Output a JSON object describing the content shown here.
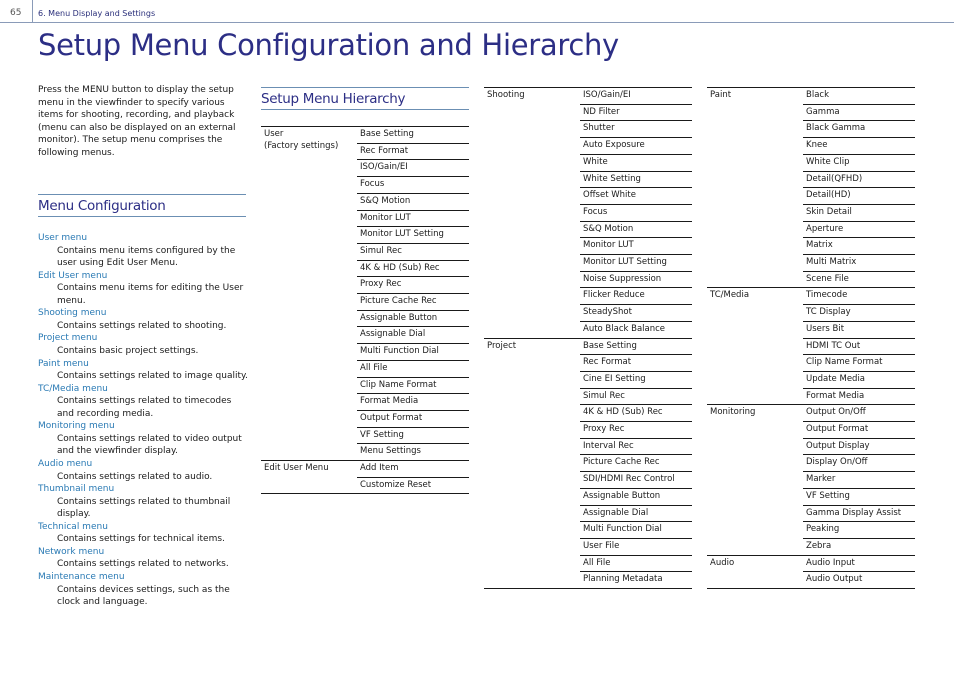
{
  "header": {
    "page_number": "65",
    "section": "6. Menu Display and Settings"
  },
  "title": "Setup Menu Configuration and Hierarchy",
  "intro": "Press the MENU button to display the setup menu in the viewfinder to specify various items for shooting, recording, and playback (menu can also be displayed on an external monitor). The setup menu comprises the following menus.",
  "menu_configuration": {
    "heading": "Menu Configuration",
    "entries": [
      {
        "name": "User menu",
        "desc": "Contains menu items configured by the user using Edit User Menu."
      },
      {
        "name": "Edit User menu",
        "desc": "Contains menu items for editing the User menu."
      },
      {
        "name": "Shooting menu",
        "desc": "Contains settings related to shooting."
      },
      {
        "name": "Project menu",
        "desc": "Contains basic project settings."
      },
      {
        "name": "Paint menu",
        "desc": "Contains settings related to image quality."
      },
      {
        "name": "TC/Media menu",
        "desc": "Contains settings related to timecodes and recording media."
      },
      {
        "name": "Monitoring menu",
        "desc": "Contains settings related to video output and the viewfinder display."
      },
      {
        "name": "Audio menu",
        "desc": "Contains settings related to audio."
      },
      {
        "name": "Thumbnail menu",
        "desc": "Contains settings related to thumbnail display."
      },
      {
        "name": "Technical menu",
        "desc": "Contains settings for technical items."
      },
      {
        "name": "Network menu",
        "desc": "Contains settings related to networks."
      },
      {
        "name": "Maintenance menu",
        "desc": "Contains devices settings, such as the clock and language."
      }
    ]
  },
  "hierarchy": {
    "heading": "Setup Menu Hierarchy",
    "tables": [
      [
        {
          "group": "User\n(Factory settings)",
          "items": [
            "Base Setting",
            "Rec Format",
            "ISO/Gain/EI",
            "Focus",
            "S&Q Motion",
            "Monitor LUT",
            "Monitor LUT Setting",
            "Simul Rec",
            "4K & HD (Sub) Rec",
            "Proxy Rec",
            "Picture Cache Rec",
            "Assignable Button",
            "Assignable Dial",
            "Multi Function Dial",
            "All File",
            "Clip Name Format",
            "Format Media",
            "Output Format",
            "VF Setting",
            "Menu Settings"
          ]
        },
        {
          "group": "Edit User Menu",
          "items": [
            "Add Item",
            "Customize Reset"
          ]
        }
      ],
      [
        {
          "group": "Shooting",
          "items": [
            "ISO/Gain/EI",
            "ND Filter",
            "Shutter",
            "Auto Exposure",
            "White",
            "White Setting",
            "Offset White",
            "Focus",
            "S&Q Motion",
            "Monitor LUT",
            "Monitor LUT Setting",
            "Noise Suppression",
            "Flicker Reduce",
            "SteadyShot",
            "Auto Black Balance"
          ]
        },
        {
          "group": "Project",
          "items": [
            "Base Setting",
            "Rec Format",
            "Cine EI Setting",
            "Simul Rec",
            "4K & HD (Sub) Rec",
            "Proxy Rec",
            "Interval Rec",
            "Picture Cache Rec",
            "SDI/HDMI Rec Control",
            "Assignable Button",
            "Assignable Dial",
            "Multi Function Dial",
            "User File",
            "All File",
            "Planning Metadata"
          ]
        }
      ],
      [
        {
          "group": "Paint",
          "items": [
            "Black",
            "Gamma",
            "Black Gamma",
            "Knee",
            "White Clip",
            "Detail(QFHD)",
            "Detail(HD)",
            "Skin Detail",
            "Aperture",
            "Matrix",
            "Multi Matrix",
            "Scene File"
          ]
        },
        {
          "group": "TC/Media",
          "items": [
            "Timecode",
            "TC Display",
            "Users Bit",
            "HDMI TC Out",
            "Clip Name Format",
            "Update Media",
            "Format Media"
          ]
        },
        {
          "group": "Monitoring",
          "items": [
            "Output On/Off",
            "Output Format",
            "Output Display",
            "Display On/Off",
            "Marker",
            "VF Setting",
            "Gamma Display Assist",
            "Peaking",
            "Zebra"
          ]
        },
        {
          "group": "Audio",
          "items": [
            "Audio Input",
            "Audio Output"
          ]
        }
      ]
    ]
  }
}
